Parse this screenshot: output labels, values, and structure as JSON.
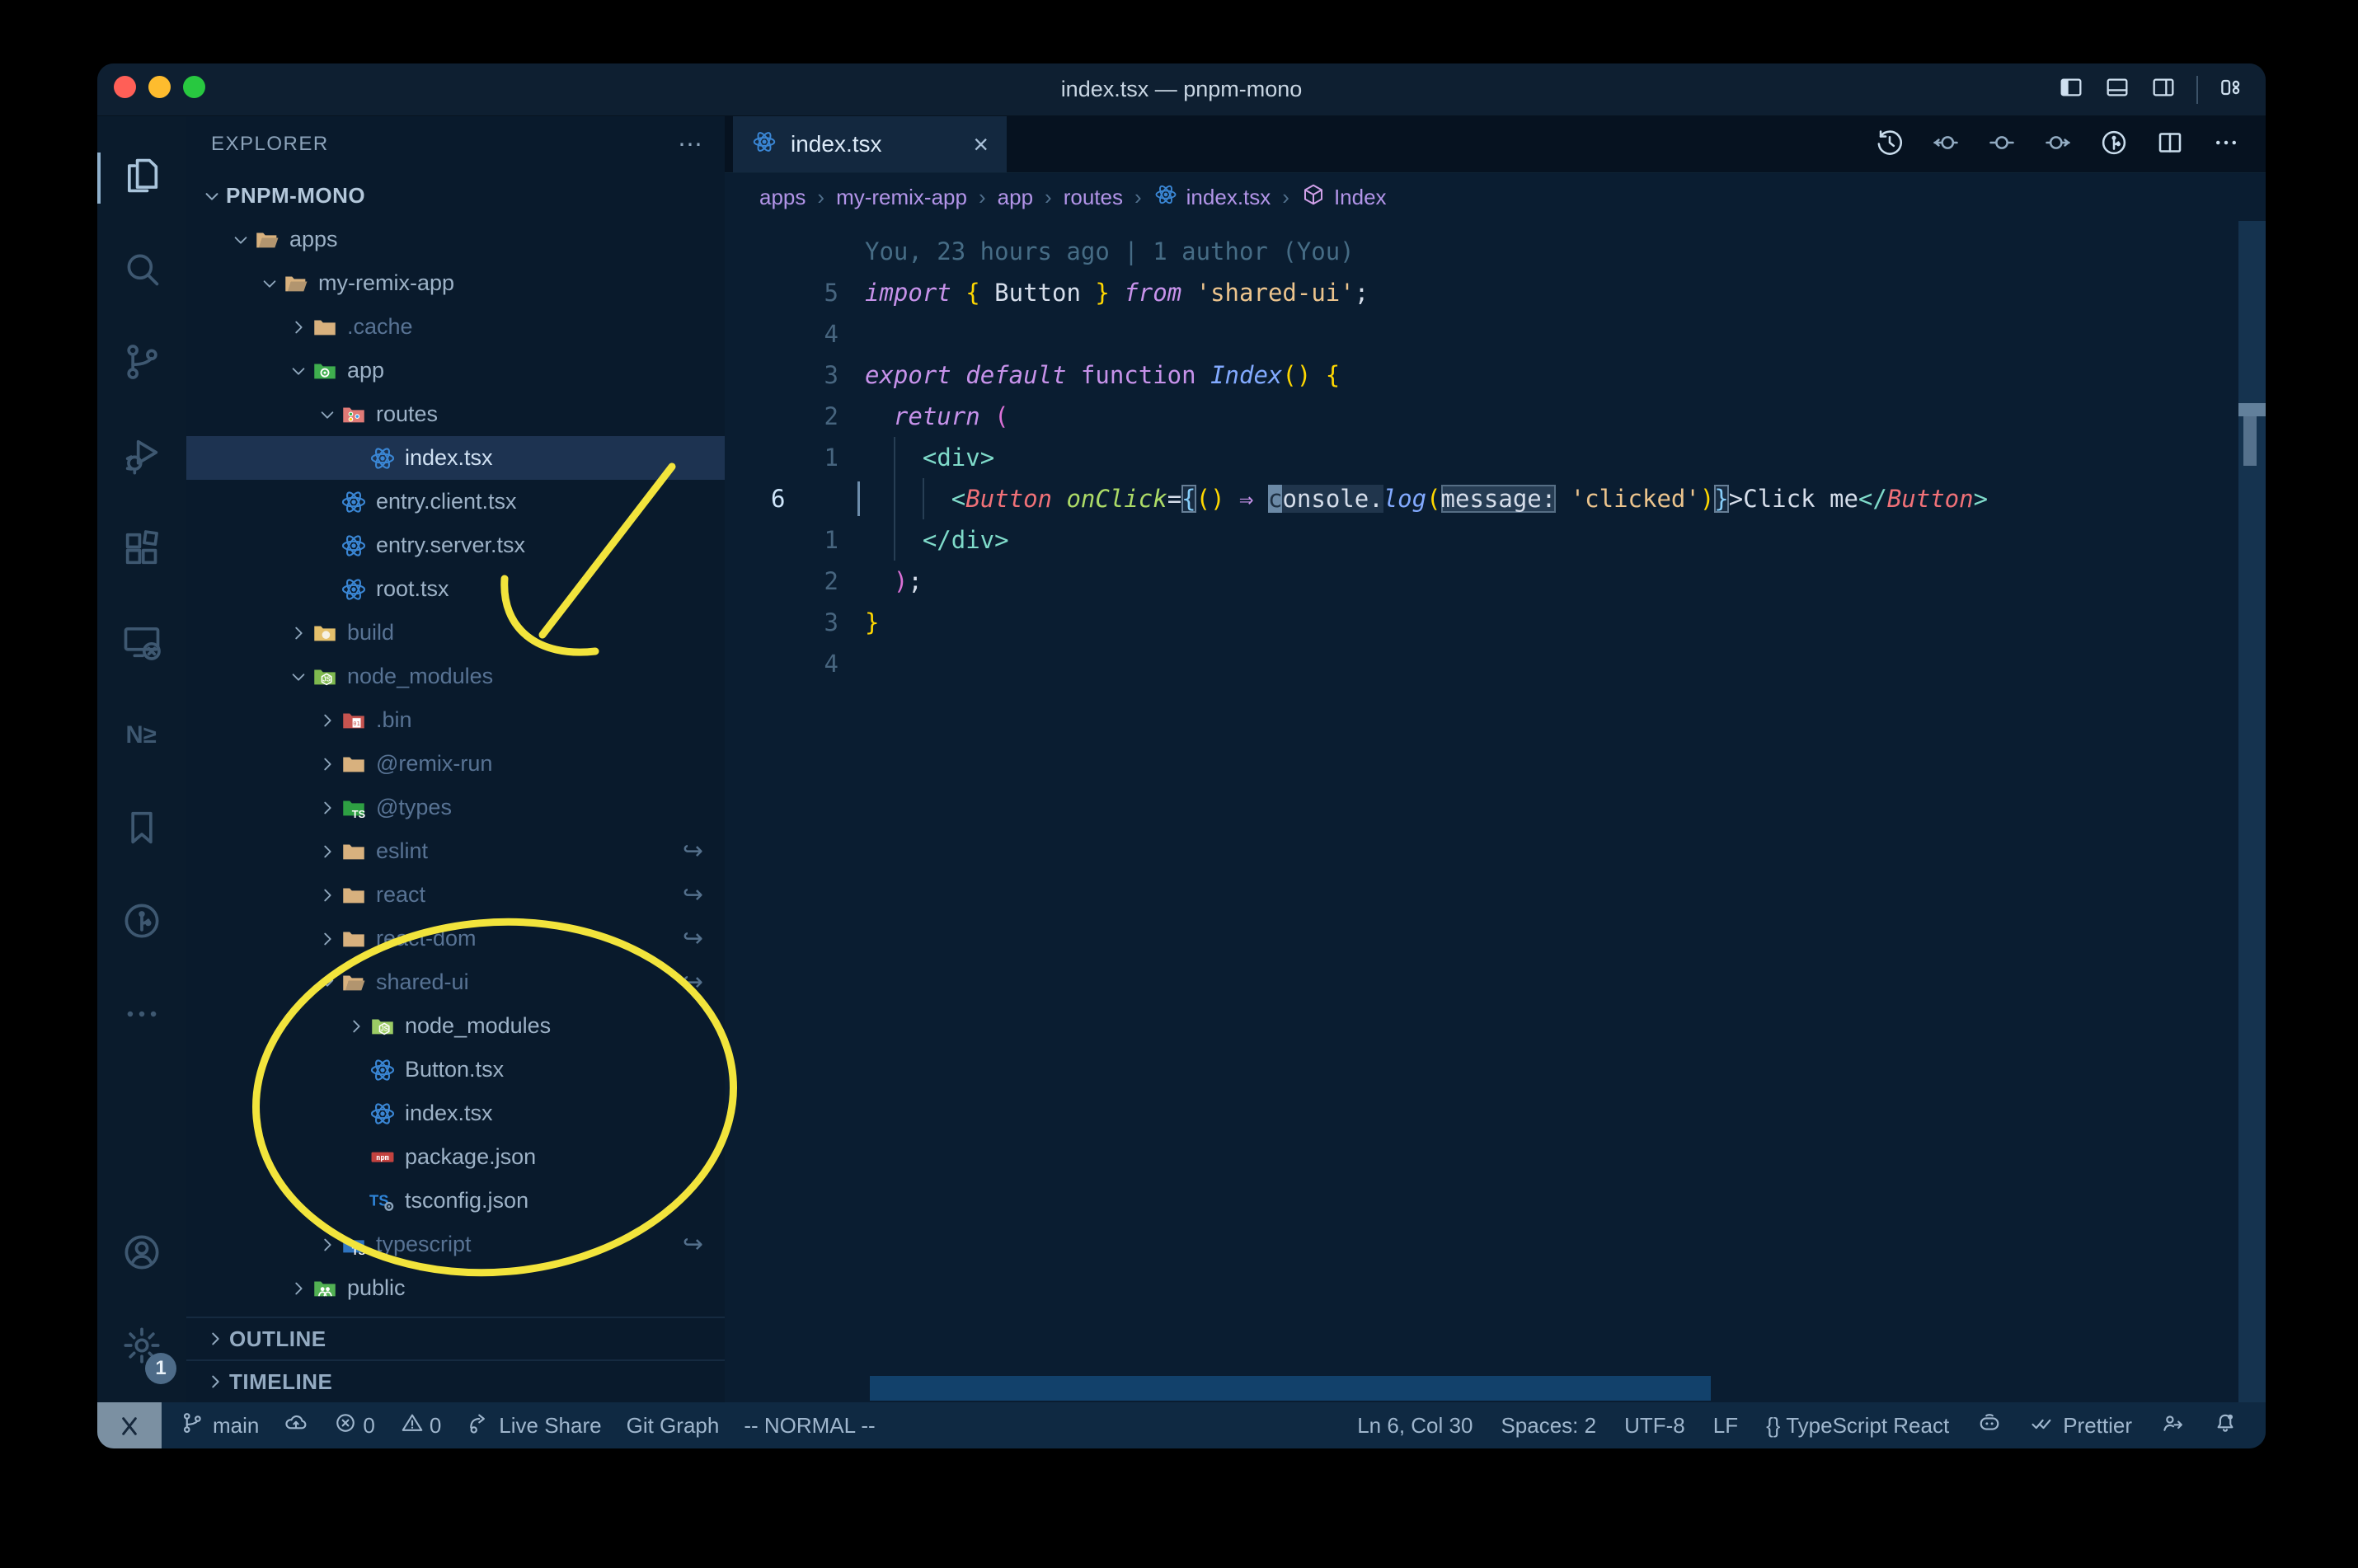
{
  "window": {
    "title": "index.tsx — pnpm-mono",
    "traffic_lights": [
      "#ff5f57",
      "#febc2e",
      "#28c840"
    ],
    "titlebar_icons": [
      "layout-sidebar-left-icon",
      "layout-panel-icon",
      "layout-sidebar-right-icon",
      "layout-customize-icon"
    ]
  },
  "activity_bar": {
    "top_items": [
      {
        "name": "explorer",
        "icon": "files-icon",
        "active": true
      },
      {
        "name": "search",
        "icon": "search-icon"
      },
      {
        "name": "source-control",
        "icon": "git-branch-icon"
      },
      {
        "name": "run-debug",
        "icon": "debug-icon"
      },
      {
        "name": "extensions",
        "icon": "extensions-icon"
      },
      {
        "name": "remote-explorer",
        "icon": "remote-explorer-icon"
      },
      {
        "name": "nx-console",
        "icon": "nx-icon"
      },
      {
        "name": "bookmarks",
        "icon": "bookmark-icon"
      },
      {
        "name": "gitlens",
        "icon": "gitlens-icon"
      },
      {
        "name": "more-views",
        "icon": "ellipsis-icon"
      }
    ],
    "bottom_items": [
      {
        "name": "account",
        "icon": "account-icon"
      },
      {
        "name": "settings",
        "icon": "gear-icon",
        "badge": "1"
      }
    ]
  },
  "explorer": {
    "header": "EXPLORER",
    "header_actions": "⋯",
    "root": "PNPM-MONO",
    "tree": [
      {
        "label": "apps",
        "level": 1,
        "icon": "folder-open-tan",
        "expanded": true
      },
      {
        "label": "my-remix-app",
        "level": 2,
        "icon": "folder-open-tan",
        "expanded": true
      },
      {
        "label": ".cache",
        "level": 3,
        "icon": "folder-tan",
        "expanded": false,
        "dim": true
      },
      {
        "label": "app",
        "level": 3,
        "icon": "folder-app-green",
        "expanded": true
      },
      {
        "label": "routes",
        "level": 4,
        "icon": "folder-routes-red",
        "expanded": true
      },
      {
        "label": "index.tsx",
        "level": 5,
        "icon": "react-icon",
        "selected": true
      },
      {
        "label": "entry.client.tsx",
        "level": 4,
        "icon": "react-icon"
      },
      {
        "label": "entry.server.tsx",
        "level": 4,
        "icon": "react-icon"
      },
      {
        "label": "root.tsx",
        "level": 4,
        "icon": "react-icon"
      },
      {
        "label": "build",
        "level": 3,
        "icon": "folder-build-yellow",
        "expanded": false,
        "dim": true
      },
      {
        "label": "node_modules",
        "level": 3,
        "icon": "folder-node-green",
        "expanded": true,
        "dim": true
      },
      {
        "label": ".bin",
        "level": 4,
        "icon": "folder-bin-red",
        "expanded": false,
        "dim": true
      },
      {
        "label": "@remix-run",
        "level": 4,
        "icon": "folder-tan",
        "expanded": false,
        "dim": true
      },
      {
        "label": "@types",
        "level": 4,
        "icon": "folder-types-green",
        "expanded": false,
        "dim": true
      },
      {
        "label": "eslint",
        "level": 4,
        "icon": "folder-tan",
        "expanded": false,
        "dim": true,
        "symlink": true
      },
      {
        "label": "react",
        "level": 4,
        "icon": "folder-tan",
        "expanded": false,
        "dim": true,
        "symlink": true
      },
      {
        "label": "react-dom",
        "level": 4,
        "icon": "folder-tan",
        "expanded": false,
        "dim": true,
        "symlink": true
      },
      {
        "label": "shared-ui",
        "level": 4,
        "icon": "folder-open-tan",
        "expanded": true,
        "dim": true,
        "symlink": true
      },
      {
        "label": "node_modules",
        "level": 5,
        "icon": "folder-node-light",
        "expanded": false
      },
      {
        "label": "Button.tsx",
        "level": 5,
        "icon": "react-icon"
      },
      {
        "label": "index.tsx",
        "level": 5,
        "icon": "react-icon"
      },
      {
        "label": "package.json",
        "level": 5,
        "icon": "npm-icon"
      },
      {
        "label": "tsconfig.json",
        "level": 5,
        "icon": "tsconfig-icon"
      },
      {
        "label": "typescript",
        "level": 4,
        "icon": "folder-ts-blue",
        "expanded": false,
        "dim": true,
        "symlink": true
      },
      {
        "label": "public",
        "level": 3,
        "icon": "folder-public-green",
        "expanded": false
      }
    ],
    "sections": [
      "OUTLINE",
      "TIMELINE"
    ]
  },
  "editor": {
    "tab": {
      "label": "index.tsx",
      "icon": "react-icon",
      "close": "×"
    },
    "actions": [
      "history-icon",
      "prev-change-icon",
      "current-change-icon",
      "next-change-icon",
      "gitlens-graph-icon",
      "split-editor-icon",
      "more-actions-icon"
    ],
    "breadcrumbs": [
      {
        "label": "apps"
      },
      {
        "label": "my-remix-app"
      },
      {
        "label": "app"
      },
      {
        "label": "routes"
      },
      {
        "label": "index.tsx",
        "icon": "react-icon"
      },
      {
        "label": "Index",
        "icon": "symbol-module-icon"
      }
    ],
    "blame": "You, 23 hours ago | 1 author (You)",
    "lines": [
      {
        "num": "5",
        "tokens": [
          {
            "t": "import",
            "s": "kwi"
          },
          {
            "t": " ",
            "s": "fg"
          },
          {
            "t": "{",
            "s": "b1"
          },
          {
            "t": " Button ",
            "s": "fg"
          },
          {
            "t": "}",
            "s": "b1"
          },
          {
            "t": " ",
            "s": "fg"
          },
          {
            "t": "from",
            "s": "kwi"
          },
          {
            "t": " ",
            "s": "fg"
          },
          {
            "t": "'shared-ui'",
            "s": "str"
          },
          {
            "t": ";",
            "s": "fg"
          }
        ]
      },
      {
        "num": "4",
        "tokens": []
      },
      {
        "num": "3",
        "tokens": [
          {
            "t": "export",
            "s": "kwi"
          },
          {
            "t": " ",
            "s": "fg"
          },
          {
            "t": "default",
            "s": "kwi"
          },
          {
            "t": " ",
            "s": "fg"
          },
          {
            "t": "function",
            "s": "kw"
          },
          {
            "t": " ",
            "s": "fg"
          },
          {
            "t": "Index",
            "s": "fni"
          },
          {
            "t": "(",
            "s": "b1"
          },
          {
            "t": ")",
            "s": "b1"
          },
          {
            "t": " ",
            "s": "fg"
          },
          {
            "t": "{",
            "s": "b1"
          }
        ]
      },
      {
        "num": "2",
        "tokens": [
          {
            "t": "  ",
            "s": "fg"
          },
          {
            "t": "return",
            "s": "kwi"
          },
          {
            "t": " ",
            "s": "fg"
          },
          {
            "t": "(",
            "s": "b2"
          }
        ]
      },
      {
        "num": "1",
        "guides": [
          2
        ],
        "tokens": [
          {
            "t": "    ",
            "s": "fg"
          },
          {
            "t": "<",
            "s": "tagp"
          },
          {
            "t": "div",
            "s": "tag"
          },
          {
            "t": ">",
            "s": "tagp"
          }
        ]
      },
      {
        "num": "6",
        "current": true,
        "guides": [
          2,
          4
        ],
        "tokens": [
          {
            "t": "      ",
            "s": "fg"
          },
          {
            "t": "<",
            "s": "tagp"
          },
          {
            "t": "Button",
            "s": "comp"
          },
          {
            "t": " ",
            "s": "fg"
          },
          {
            "t": "onClick",
            "s": "attri"
          },
          {
            "t": "=",
            "s": "fg"
          },
          {
            "t": "{",
            "s": "b3",
            "m": "box"
          },
          {
            "t": "(",
            "s": "b1"
          },
          {
            "t": ")",
            "s": "b1"
          },
          {
            "t": " ",
            "s": "fg"
          },
          {
            "t": "⇒",
            "s": "arrow"
          },
          {
            "t": " ",
            "s": "fg"
          },
          {
            "t": "c",
            "s": "fg",
            "m": "cursor"
          },
          {
            "t": "onsole",
            "s": "fg",
            "m": "hl"
          },
          {
            "t": ".",
            "s": "fg",
            "m": "hl"
          },
          {
            "t": "log",
            "s": "fni"
          },
          {
            "t": "(",
            "s": "b1"
          },
          {
            "t": "message:",
            "s": "fg",
            "m": "hl2"
          },
          {
            "t": " ",
            "s": "fg"
          },
          {
            "t": "'clicked'",
            "s": "str"
          },
          {
            "t": ")",
            "s": "b1"
          },
          {
            "t": "}",
            "s": "b3",
            "m": "box"
          },
          {
            "t": ">",
            "s": "fg"
          },
          {
            "t": "Click me",
            "s": "fg"
          },
          {
            "t": "</",
            "s": "tagp"
          },
          {
            "t": "Button",
            "s": "comp"
          },
          {
            "t": ">",
            "s": "tagp"
          }
        ]
      },
      {
        "num": "1",
        "guides": [
          2
        ],
        "tokens": [
          {
            "t": "    ",
            "s": "fg"
          },
          {
            "t": "</",
            "s": "tagp"
          },
          {
            "t": "div",
            "s": "tag"
          },
          {
            "t": ">",
            "s": "tagp"
          }
        ]
      },
      {
        "num": "2",
        "tokens": [
          {
            "t": "  ",
            "s": "fg"
          },
          {
            "t": ")",
            "s": "b2"
          },
          {
            "t": ";",
            "s": "fg"
          }
        ]
      },
      {
        "num": "3",
        "tokens": [
          {
            "t": "}",
            "s": "b1"
          }
        ]
      },
      {
        "num": "4",
        "tokens": []
      }
    ]
  },
  "status_bar": {
    "left": [
      {
        "name": "remote",
        "icon": "remote-icon"
      },
      {
        "name": "git-branch",
        "icon": "branch-icon",
        "label": "main"
      },
      {
        "name": "publish",
        "icon": "cloud-upload-icon"
      },
      {
        "name": "errors",
        "icon": "error-icon",
        "label": "0"
      },
      {
        "name": "warnings",
        "icon": "warning-icon",
        "label": "0"
      },
      {
        "name": "live-share",
        "icon": "live-share-icon",
        "label": "Live Share"
      },
      {
        "name": "git-graph",
        "label": "Git Graph"
      },
      {
        "name": "vim-mode",
        "label": "-- NORMAL --"
      }
    ],
    "right": [
      {
        "name": "cursor-position",
        "label": "Ln 6, Col 30"
      },
      {
        "name": "indentation",
        "label": "Spaces: 2"
      },
      {
        "name": "encoding",
        "label": "UTF-8"
      },
      {
        "name": "eol",
        "label": "LF"
      },
      {
        "name": "language-mode",
        "label": "{} TypeScript React"
      },
      {
        "name": "copilot",
        "icon": "copilot-icon"
      },
      {
        "name": "prettier",
        "icon": "double-check-icon",
        "label": "Prettier"
      },
      {
        "name": "feedback",
        "icon": "feedback-icon"
      },
      {
        "name": "notifications",
        "icon": "bell-icon",
        "badge": true
      }
    ]
  },
  "annotations": {
    "color": "#f2e43c",
    "shapes": [
      "hand-drawn-arrow-to-node-modules",
      "hand-drawn-ellipse-around-shared-ui-files"
    ]
  },
  "colors": {
    "editor_bg": "#0a1d31",
    "sidebar_bg": "#091a2c",
    "statusbar_bg": "#0f2942",
    "selection_row": "#1d3351",
    "keyword": "#c792ea",
    "string": "#ecc48d",
    "function": "#82aaff",
    "tag": "#7fdbca",
    "component": "#f07178",
    "attribute": "#addb67",
    "bracket1": "#ffd700",
    "bracket2": "#da70d6",
    "bracket3": "#87cefa",
    "react_icon_blue": "#3a86d4",
    "folder_tan": "#d8b17e",
    "npm_red": "#c3423f"
  }
}
